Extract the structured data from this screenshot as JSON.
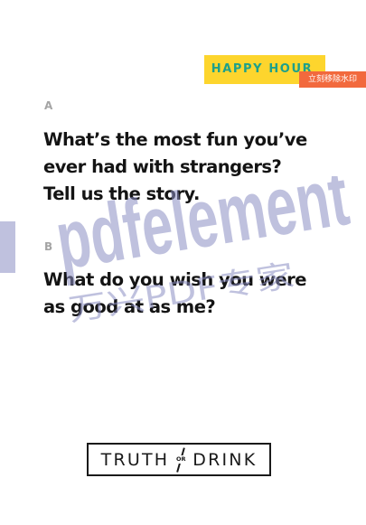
{
  "card": {
    "category": "HAPPY HOUR",
    "category_color": "#1ea08a",
    "badge_color": "#fdd52d",
    "questions": [
      {
        "letter": "A",
        "lines": [
          "What’s the most fun you’ve",
          "ever had with strangers?",
          "Tell us the story."
        ]
      },
      {
        "letter": "B",
        "lines": [
          "What do you wish you were",
          "as good at as me?"
        ]
      }
    ]
  },
  "logo": {
    "left_word": "TRUTH",
    "connector": "OR",
    "right_word": "DRINK"
  },
  "watermark": {
    "brand": "pdfelement",
    "subtitle": "万兴PDF专家",
    "remove_label": "立刻移除水印",
    "remove_button_color": "#f2693d",
    "tint_color": "#8c8fc4"
  }
}
